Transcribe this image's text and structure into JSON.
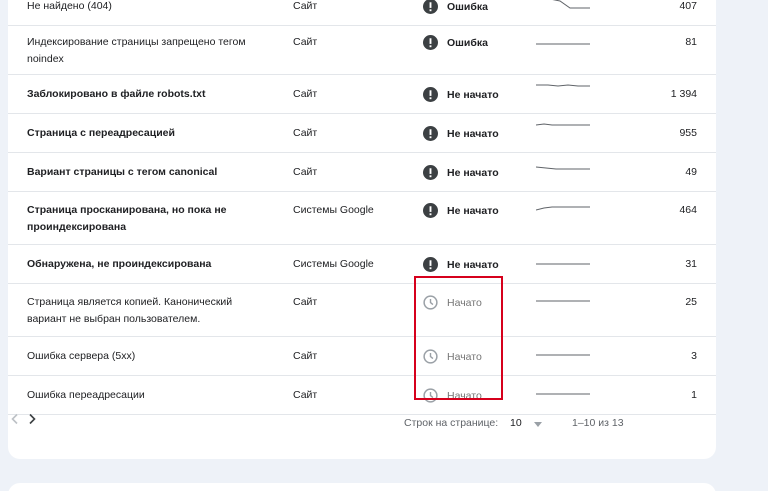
{
  "colors": {
    "error_icon": "#3c4043",
    "started_icon": "#9aa0a6",
    "highlight_border": "#d6001c",
    "background": "#eef2f8"
  },
  "table": {
    "rows": [
      {
        "reason": "Не найдено (404)",
        "source": "Сайт",
        "status": "Ошибка",
        "status_kind": "error",
        "count": "407",
        "bold": false
      },
      {
        "reason": "Индексирование страницы запрещено тегом noindex",
        "source": "Сайт",
        "status": "Ошибка",
        "status_kind": "error",
        "count": "81",
        "bold": false
      },
      {
        "reason": "Заблокировано в файле robots.txt",
        "source": "Сайт",
        "status": "Не начато",
        "status_kind": "not-started",
        "count": "1 394",
        "bold": true
      },
      {
        "reason": "Страница с переадресацией",
        "source": "Сайт",
        "status": "Не начато",
        "status_kind": "not-started",
        "count": "955",
        "bold": true
      },
      {
        "reason": "Вариант страницы с тегом canonical",
        "source": "Сайт",
        "status": "Не начато",
        "status_kind": "not-started",
        "count": "49",
        "bold": true
      },
      {
        "reason": "Страница просканирована, но пока не проиндексирована",
        "source": "Системы Google",
        "status": "Не начато",
        "status_kind": "not-started",
        "count": "464",
        "bold": true
      },
      {
        "reason": "Обнаружена, не проиндексирована",
        "source": "Системы Google",
        "status": "Не начато",
        "status_kind": "not-started",
        "count": "31",
        "bold": true
      },
      {
        "reason": "Страница является копией. Канонический вариант не выбран пользователем.",
        "source": "Сайт",
        "status": "Начато",
        "status_kind": "started",
        "count": "25",
        "bold": false
      },
      {
        "reason": "Ошибка сервера (5xx)",
        "source": "Сайт",
        "status": "Начато",
        "status_kind": "started",
        "count": "3",
        "bold": false
      },
      {
        "reason": "Ошибка переадресации",
        "source": "Сайт",
        "status": "Начато",
        "status_kind": "started",
        "count": "1",
        "bold": false
      }
    ]
  },
  "pagination": {
    "rows_per_page_label": "Строк на странице:",
    "rows_per_page_value": "10",
    "range": "1–10 из 13"
  },
  "icons": {
    "error": "exclamation-circle-icon",
    "started": "clock-icon",
    "prev": "chevron-left-icon",
    "next": "chevron-right-icon",
    "dropdown": "caret-down-icon"
  }
}
